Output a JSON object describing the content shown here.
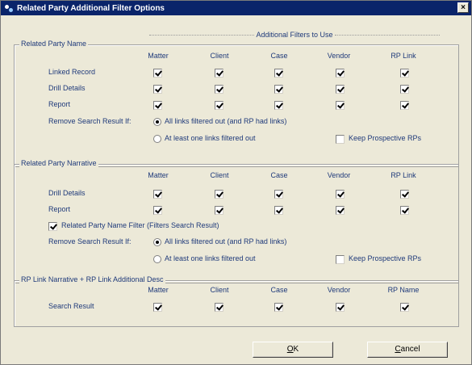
{
  "window": {
    "title": "Related Party Additional Filter Options",
    "close_label": "×"
  },
  "additional_header": "Additional Filters to Use",
  "sections": [
    {
      "title": "Related Party Name",
      "columns": [
        "Matter",
        "Client",
        "Case",
        "Vendor",
        "RP Link"
      ],
      "rows": [
        {
          "label": "Linked Record",
          "checks": [
            true,
            true,
            true,
            true,
            true
          ]
        },
        {
          "label": "Drill Details",
          "checks": [
            true,
            true,
            true,
            true,
            true
          ]
        },
        {
          "label": "Report",
          "checks": [
            true,
            true,
            true,
            true,
            true
          ]
        }
      ],
      "remove_label": "Remove Search Result If:",
      "radio_all": "All links filtered out (and RP had links)",
      "radio_one": "At least one links filtered out",
      "radio_selected": "all",
      "keep_prospective": "Keep Prospective RPs",
      "keep_checked": false
    },
    {
      "title": "Related Party Narrative",
      "columns": [
        "Matter",
        "Client",
        "Case",
        "Vendor",
        "RP Link"
      ],
      "rows": [
        {
          "label": "Drill Details",
          "checks": [
            true,
            true,
            true,
            true,
            true
          ]
        },
        {
          "label": "Report",
          "checks": [
            true,
            true,
            true,
            true,
            true
          ]
        }
      ],
      "name_filter": "Related Party Name Filter (Filters Search Result)",
      "name_filter_checked": true,
      "remove_label": "Remove Search Result If:",
      "radio_all": "All links filtered out (and RP had links)",
      "radio_one": "At least one links filtered out",
      "radio_selected": "all",
      "keep_prospective": "Keep Prospective RPs",
      "keep_checked": false
    },
    {
      "title": "RP Link Narrative + RP Link Additional Desc",
      "columns": [
        "Matter",
        "Client",
        "Case",
        "Vendor",
        "RP Name"
      ],
      "rows": [
        {
          "label": "Search Result",
          "checks": [
            true,
            true,
            true,
            true,
            true
          ]
        }
      ]
    }
  ],
  "buttons": {
    "ok_key": "O",
    "ok_rest": "K",
    "cancel_key": "C",
    "cancel_rest": "ancel"
  }
}
